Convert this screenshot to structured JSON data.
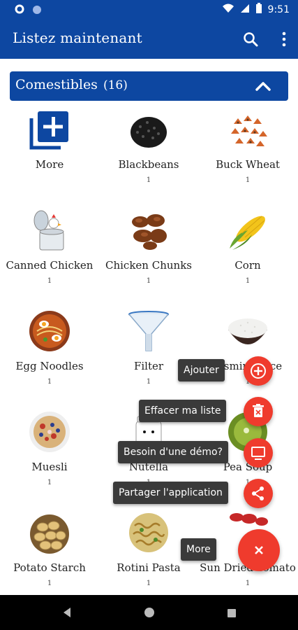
{
  "status": {
    "time": "9:51"
  },
  "app": {
    "title": "Listez maintenant"
  },
  "section": {
    "label": "Comestibles",
    "count": "(16)"
  },
  "items": [
    {
      "name": "More",
      "qty": ""
    },
    {
      "name": "Blackbeans",
      "qty": "1"
    },
    {
      "name": "Buck Wheat",
      "qty": "1"
    },
    {
      "name": "Canned Chicken",
      "qty": "1"
    },
    {
      "name": "Chicken Chunks",
      "qty": "1"
    },
    {
      "name": "Corn",
      "qty": "1"
    },
    {
      "name": "Egg Noodles",
      "qty": "1"
    },
    {
      "name": "Filter",
      "qty": "1"
    },
    {
      "name": "Jasmine Rice",
      "qty": "1"
    },
    {
      "name": "Muesli",
      "qty": "1"
    },
    {
      "name": "Nutella",
      "qty": "1"
    },
    {
      "name": "Pea Soup",
      "qty": "1"
    },
    {
      "name": "Potato Starch",
      "qty": "1"
    },
    {
      "name": "Rotini Pasta",
      "qty": "1"
    },
    {
      "name": "Sun Dried Tomato",
      "qty": "1"
    }
  ],
  "fab_menu": {
    "add": "Ajouter",
    "clear": "Effacer ma liste",
    "demo": "Besoin d'une démo?",
    "share": "Partager l'application",
    "more": "More"
  },
  "colors": {
    "primary": "#0d47a1",
    "fab": "#ef3b2d"
  }
}
